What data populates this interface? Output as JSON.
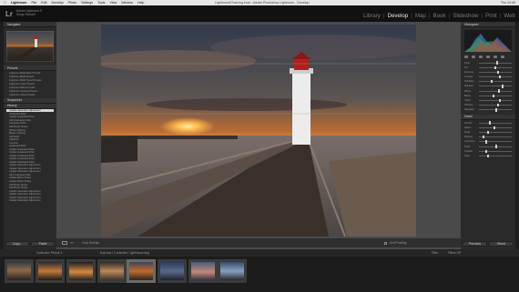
{
  "menubar": {
    "apple": "",
    "items": [
      "Lightroom",
      "File",
      "Edit",
      "Develop",
      "Photo",
      "Settings",
      "Tools",
      "View",
      "Window",
      "Help"
    ],
    "window_title": "Lightroom5Training.lrcat - Adobe Photoshop Lightroom - Develop",
    "right_text": "Thu 10:45"
  },
  "identity": {
    "logo": "Lr",
    "catalog_line1": "Adobe Lightroom 5",
    "catalog_line2": "Serge Ramelli"
  },
  "modules": [
    "Library",
    "Develop",
    "Map",
    "Book",
    "Slideshow",
    "Print",
    "Web"
  ],
  "active_module": "Develop",
  "left_panel": {
    "navigator_label": "Navigator",
    "presets_label": "Presets",
    "presets": [
      "Lightroom B&W Filter Presets",
      "Lightroom B&W Presets",
      "Lightroom B&W Toned Presets",
      "Lightroom Color Presets",
      "Lightroom Effect Presets",
      "Lightroom General Presets",
      "Lightroom Video Presets"
    ],
    "snapshots_label": "Snapshots",
    "history_label": "History",
    "history": [
      "Update Saturation Adjustment",
      "Graduated Filter",
      "Update Graduated Filter",
      "Add Graduated Filter",
      "Graduated Filter",
      "Add Brush Stroke",
      "Whites Clipping",
      "Blacks Clipping",
      "Highlights",
      "Shadows",
      "Contrast",
      "Graduated Filter",
      "Update Graduated Filter",
      "Update Graduated Filter",
      "Update Graduated Filter",
      "Update Graduated Filter",
      "Update Graduated Filter",
      "Update Saturation Adjustment",
      "Update Saturation Adjustment",
      "Update Saturation Adjustment",
      "Add Graduated Filter",
      "Update Brush Stroke",
      "Update Brush Stroke",
      "Add Brush Stroke",
      "Add Brush Stroke",
      "Update Saturation Adjustment",
      "Update Saturation Adjustment",
      "Update Saturation Adjustment",
      "Update Saturation Adjustment"
    ],
    "copy_label": "Copy...",
    "paste_label": "Paste"
  },
  "right_panel": {
    "histogram_label": "Histogram",
    "tone_sliders": [
      "Temp",
      "Tint",
      "Exposure",
      "Contrast",
      "Highlights",
      "Shadows",
      "Whites",
      "Blacks",
      "Clarity",
      "Vibrance",
      "Saturation"
    ],
    "tone_values": [
      0.52,
      0.48,
      0.55,
      0.6,
      0.35,
      0.7,
      0.58,
      0.42,
      0.62,
      0.55,
      0.5
    ],
    "detail_label": "Detail",
    "detail_sliders": [
      "Amount",
      "Radius",
      "Detail",
      "Masking",
      "Luminance",
      "Detail",
      "Contrast",
      "Color"
    ],
    "detail_values": [
      0.3,
      0.45,
      0.25,
      0.1,
      0.2,
      0.5,
      0.2,
      0.25
    ],
    "previous_label": "Previous",
    "reset_label": "Reset"
  },
  "toolbar": {
    "soft_proofing": "Soft Proofing",
    "crop_overlay": "Crop Overlay"
  },
  "filmstrip_bar": {
    "collection": "Collection: Picture 1",
    "counts": "8 photos / 1 selected / Lighthouse.dng",
    "filter": "Filter:",
    "filters_off": "Filters Off"
  },
  "colors": {
    "accent": "#e8e8e8",
    "panel": "#2a2a2a",
    "background": "#4a4a4a"
  }
}
